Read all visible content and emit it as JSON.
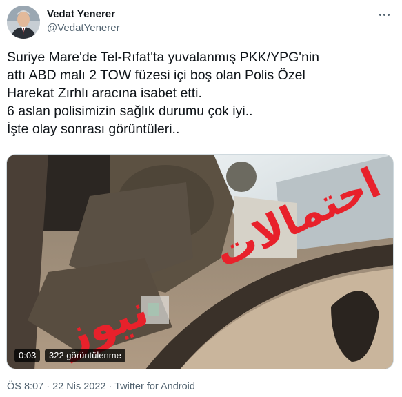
{
  "author": {
    "display_name": "Vedat Yenerer",
    "handle": "@VedatYenerer"
  },
  "tweet": {
    "lines": [
      "Suriye Mare'de Tel-Rıfat'ta yuvalanmış PKK/YPG'nin",
      "attı ABD malı 2 TOW füzesi içi boş olan Polis Özel",
      "Harekat Zırhlı aracına isabet etti.",
      "6 aslan polisimizin sağlık durumu çok iyi..",
      "İşte olay sonrası görüntüleri.."
    ]
  },
  "video": {
    "duration": "0:03",
    "views": "322 görüntülenme",
    "watermark": "احتمالات نيوز"
  },
  "footer": {
    "time": "ÖS 8:07",
    "separator": " · ",
    "date": "22 Nis 2022",
    "source": "Twitter for Android"
  },
  "colors": {
    "text": "#0f1419",
    "secondary": "#536471",
    "watermark": "#e8212b"
  },
  "icons": {
    "more": "more-horizontal-icon"
  }
}
